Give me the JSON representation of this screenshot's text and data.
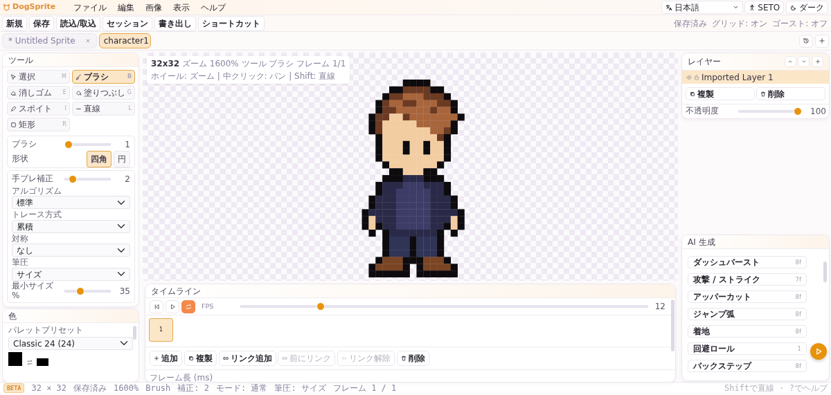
{
  "app": {
    "name": "DogSprite"
  },
  "menu": [
    {
      "label": "ファイル"
    },
    {
      "label": "編集"
    },
    {
      "label": "画像"
    },
    {
      "label": "表示"
    },
    {
      "label": "ヘルプ"
    }
  ],
  "language": "日本語",
  "user": "SETO",
  "theme_button": "ダーク",
  "toolbar": [
    {
      "label": "新規"
    },
    {
      "label": "保存"
    },
    {
      "label": "読込/取込"
    },
    {
      "label": "セッション"
    },
    {
      "label": "書き出し"
    },
    {
      "label": "ショートカット"
    }
  ],
  "status_flags": [
    "保存済み",
    "グリッド: オン",
    "ゴースト: オフ"
  ],
  "tabs": [
    {
      "label": "* Untitled Sprite",
      "selected": false
    },
    {
      "label": "character1",
      "selected": true
    }
  ],
  "tools_panel": {
    "title": "ツール",
    "tools": [
      {
        "label": "選択",
        "key": "M",
        "selected": false
      },
      {
        "label": "ブラシ",
        "key": "B",
        "selected": true
      },
      {
        "label": "消しゴム",
        "key": "E",
        "selected": false
      },
      {
        "label": "塗りつぶし",
        "key": "G",
        "selected": false
      },
      {
        "label": "スポイト",
        "key": "I",
        "selected": false
      },
      {
        "label": "直線",
        "key": "L",
        "selected": false
      },
      {
        "label": "矩形",
        "key": "R",
        "selected": false
      }
    ],
    "brush": {
      "label": "ブラシ",
      "level": 0,
      "value": "1",
      "shape_label": "形状",
      "shapes": [
        {
          "label": "四角",
          "selected": true
        },
        {
          "label": "円",
          "selected": false
        }
      ]
    },
    "stabilizer": {
      "label": "手ブレ補正",
      "level": 0.1,
      "value": "2",
      "fields": [
        {
          "label": "アルゴリズム",
          "value": "標準"
        },
        {
          "label": "トレース方式",
          "value": "累積"
        },
        {
          "label": "対称",
          "value": "なし"
        },
        {
          "label": "筆圧",
          "value": "サイズ"
        }
      ],
      "min_size": {
        "label": "最小サイズ %",
        "level": 0.3,
        "value": "35"
      }
    }
  },
  "color_panel": {
    "title": "色",
    "preset_label": "パレットプリセット",
    "preset": "Classic 24 (24)",
    "swatches": [
      {
        "kind": "primary",
        "color": "#000000"
      },
      {
        "kind": "secondary",
        "color": "#000000"
      }
    ]
  },
  "canvas_info": [
    "**32x32** ズーム 1600% ツール ブラシ フレーム 1/1",
    "ホイール: ズーム | 中クリック: パン | Shift: 直線"
  ],
  "timeline": {
    "title": "タイムライン",
    "loop": true,
    "fps_label": "FPS",
    "level": 0.19,
    "fps": "12",
    "frames": [
      {
        "label": "1",
        "selected": true
      }
    ],
    "actions": [
      {
        "label": "追加",
        "disabled": false
      },
      {
        "label": "複製",
        "disabled": false
      },
      {
        "label": "リンク追加",
        "disabled": false
      },
      {
        "label": "前にリンク",
        "disabled": true
      },
      {
        "label": "リンク解除",
        "disabled": true
      },
      {
        "label": "削除",
        "disabled": false
      }
    ],
    "frame_length_label": "フレーム長 (ms)"
  },
  "layers": {
    "title": "レイヤー",
    "items": [
      {
        "name": "Imported Layer 1",
        "selected": true
      }
    ],
    "actions": [
      {
        "label": "複製"
      },
      {
        "label": "削除"
      }
    ],
    "opacity_label": "不透明度",
    "level": 1,
    "opacity": "100"
  },
  "ai": {
    "title": "AI 生成",
    "items": [
      {
        "label": "ダッシュバースト",
        "frames": "8f"
      },
      {
        "label": "攻撃 / ストライク",
        "frames": "7f"
      },
      {
        "label": "アッパーカット",
        "frames": "8f"
      },
      {
        "label": "ジャンプ弧",
        "frames": "8f"
      },
      {
        "label": "着地",
        "frames": "8f"
      },
      {
        "label": "回避ロール",
        "frames": "1"
      },
      {
        "label": "バックステップ",
        "frames": "8f"
      }
    ]
  },
  "status_bar": {
    "badge": "BETA",
    "items": [
      "32 × 32",
      "保存済み",
      "1600%",
      "Brush",
      "補正: 2",
      "モード: 通常",
      "筆圧: サイズ",
      "フレーム 1 / 1"
    ],
    "hint": "Shiftで直線 · ?でヘルプ"
  }
}
